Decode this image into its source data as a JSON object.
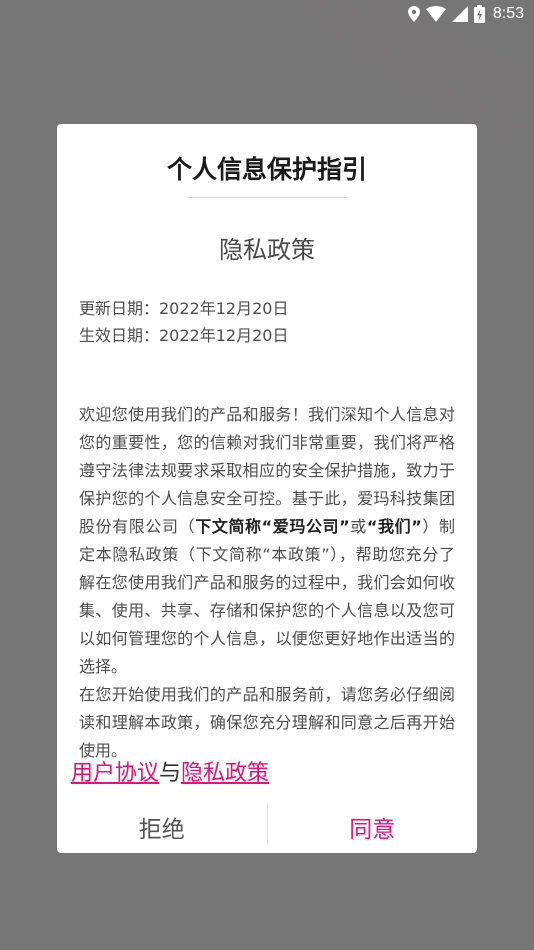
{
  "status_bar": {
    "time": "8:53",
    "icons": [
      "location-icon",
      "wifi-icon",
      "signal-icon",
      "battery-icon"
    ]
  },
  "dialog": {
    "title": "个人信息保护指引",
    "policy_heading": "隐私政策",
    "update_date": "更新日期：2022年12月20日",
    "effective_date": "生效日期：2022年12月20日",
    "paragraph1": {
      "part1": "欢迎您使用我们的产品和服务！我们深知个人信息对您的重要性，您的信赖对我们非常重要，我们将严格遵守法律法规要求采取相应的安全保护措施，致力于保护您的个人信息安全可控。基于此，爱玛科技集团股份有限公司（",
      "bold1": "下文简称“爱玛公司”",
      "part2": "或",
      "bold2": "“我们”",
      "part3": "）制定本隐私政策（下文简称“本政策”），帮助您充分了解在您使用我们产品和服务的过程中，我们会如何收集、使用、共享、存储和保护您的个人信息以及您可以如何管理您的个人信息，以便您更好地作出适当的选择。"
    },
    "paragraph2": "在您开始使用我们的产品和服务前，请您务必仔细阅读和理解本政策，确保您充分理解和同意之后再开始使用。",
    "links": {
      "user_agreement": "用户协议",
      "connector": "与",
      "privacy_policy": "隐私政策"
    },
    "buttons": {
      "reject": "拒绝",
      "agree": "同意"
    }
  },
  "colors": {
    "accent": "#e2127a",
    "overlay": "#767676"
  }
}
